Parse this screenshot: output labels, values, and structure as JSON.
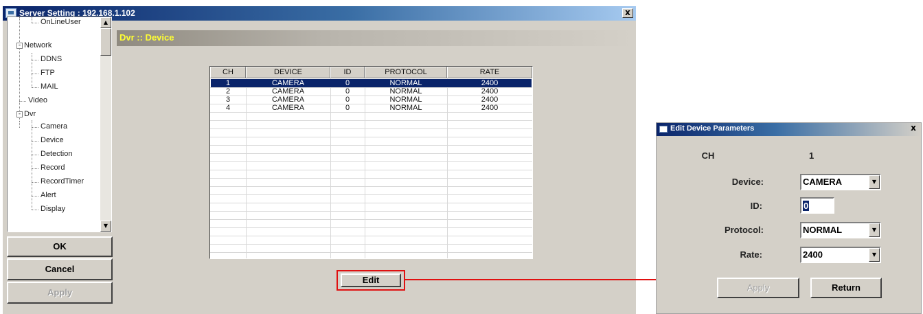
{
  "main_window": {
    "title": "Server Setting : 192.168.1.102",
    "close_label": "x",
    "tree": {
      "items": [
        {
          "label": "OnLineUser"
        },
        {
          "label": "Network"
        },
        {
          "label": "DDNS"
        },
        {
          "label": "FTP"
        },
        {
          "label": "MAIL"
        },
        {
          "label": "Video"
        },
        {
          "label": "Dvr"
        },
        {
          "label": "Camera"
        },
        {
          "label": "Device"
        },
        {
          "label": "Detection"
        },
        {
          "label": "Record"
        },
        {
          "label": "RecordTimer"
        },
        {
          "label": "Alert"
        },
        {
          "label": "Display"
        }
      ],
      "collapse_symbol": "-"
    },
    "buttons": {
      "ok": "OK",
      "cancel": "Cancel",
      "apply": "Apply"
    },
    "section_header": "Dvr :: Device",
    "table": {
      "columns": [
        "CH",
        "DEVICE",
        "ID",
        "PROTOCOL",
        "RATE"
      ],
      "rows": [
        [
          "1",
          "CAMERA",
          "0",
          "NORMAL",
          "2400"
        ],
        [
          "2",
          "CAMERA",
          "0",
          "NORMAL",
          "2400"
        ],
        [
          "3",
          "CAMERA",
          "0",
          "NORMAL",
          "2400"
        ],
        [
          "4",
          "CAMERA",
          "0",
          "NORMAL",
          "2400"
        ]
      ],
      "selected_row": 0
    },
    "edit_button": "Edit"
  },
  "dialog": {
    "title": "Edit Device Parameters",
    "close_label": "x",
    "ch_label": "CH",
    "ch_value": "1",
    "device_label": "Device:",
    "device_value": "CAMERA",
    "id_label": "ID:",
    "id_value": "0",
    "protocol_label": "Protocol:",
    "protocol_value": "NORMAL",
    "rate_label": "Rate:",
    "rate_value": "2400",
    "apply_button": "Apply",
    "return_button": "Return"
  },
  "colors": {
    "highlight": "#e01010",
    "selection": "#0a246a",
    "header_text": "#ffff33"
  }
}
